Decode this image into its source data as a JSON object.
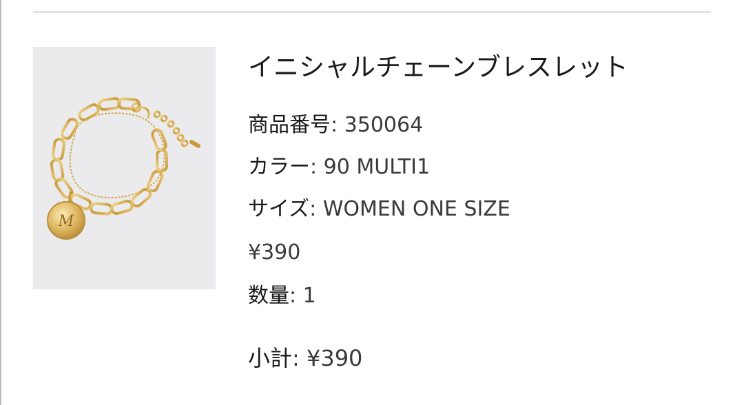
{
  "product": {
    "name": "イニシャルチェーンブレスレット",
    "image_icon": "gold-chain-bracelet-with-initial-charm",
    "sku_label": "商品番号",
    "sku_value": "350064",
    "color_label": "カラー",
    "color_value": "90 MULTI1",
    "size_label": "サイズ",
    "size_value": "WOMEN ONE SIZE",
    "price": "¥390",
    "quantity_label": "数量",
    "quantity_value": "1"
  },
  "summary": {
    "subtotal_label": "小計",
    "subtotal_value": "¥390"
  },
  "separator": ": ",
  "colors": {
    "image_background": "#ebebee",
    "gold": "#d6ae55",
    "divider": "#e3e3e3"
  }
}
